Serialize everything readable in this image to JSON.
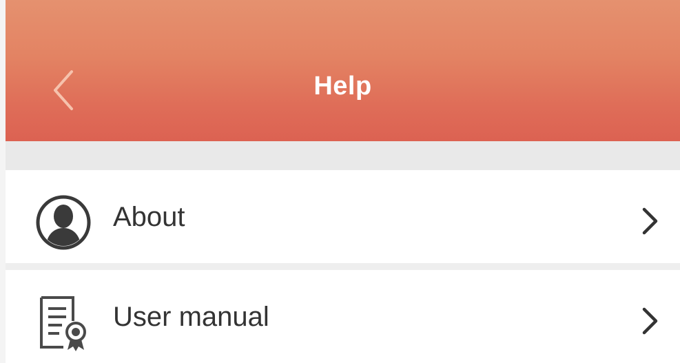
{
  "header": {
    "title": "Help",
    "back_icon": "chevron-left-icon",
    "color_top": "#e5916f",
    "color_bottom": "#dc6252"
  },
  "list": {
    "items": [
      {
        "label": "About",
        "icon": "user-silhouette-icon",
        "trailing_icon": "chevron-right-icon"
      },
      {
        "label": "User manual",
        "icon": "document-certificate-icon",
        "trailing_icon": "chevron-right-icon"
      }
    ]
  }
}
